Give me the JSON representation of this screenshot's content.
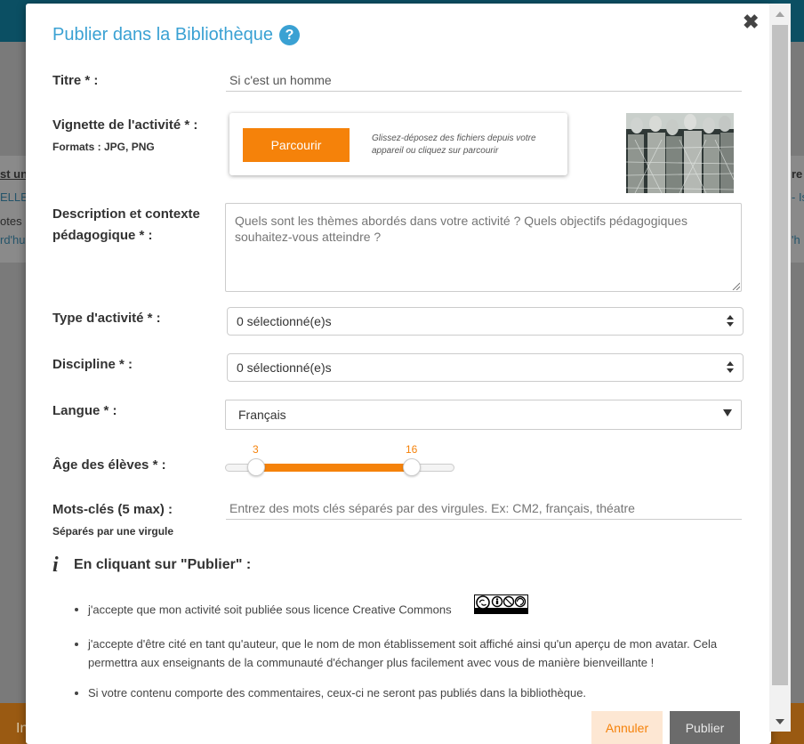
{
  "background": {
    "left_texts": [
      "st un",
      "ELLE",
      "otes",
      "rd'hu"
    ],
    "right_texts": [
      "re",
      "- Is",
      "'h"
    ],
    "bottom_text": "In"
  },
  "modal": {
    "title": "Publier dans la Bibliothèque",
    "help_glyph": "?",
    "close_glyph": "✖",
    "fields": {
      "titre_label": "Titre * :",
      "titre_value": "Si c'est un homme",
      "vignette_label": "Vignette de l'activité * :",
      "vignette_formats": "Formats : JPG, PNG",
      "browse_label": "Parcourir",
      "drop_hint": "Glissez-déposez des fichiers depuis votre appareil ou cliquez sur parcourir",
      "description_label_1": "Description et contexte",
      "description_label_2": "pédagogique * :",
      "description_placeholder": "Quels sont les thèmes abordés dans votre activité ? Quels objectifs pédagogiques souhaitez-vous atteindre ?",
      "type_label": "Type d'activité * :",
      "type_value": "0 sélectionné(e)s",
      "discipline_label": "Discipline * :",
      "discipline_value": "0 sélectionné(e)s",
      "langue_label": "Langue * :",
      "langue_value": "Français",
      "age_label": "Âge des élèves * :",
      "age_min": "3",
      "age_max": "16",
      "keywords_label": "Mots-clés (5 max) :",
      "keywords_sublabel": "Séparés par une virgule",
      "keywords_placeholder": "Entrez des mots clés séparés par des virgules. Ex: CM2, français, théatre"
    },
    "info": {
      "icon": "i",
      "title": "En cliquant sur \"Publier\" :",
      "bullets": [
        "j'accepte que mon activité soit publiée sous licence Creative Commons",
        "j'accepte d'être cité en tant qu'auteur, que le nom de mon établissement soit affiché ainsi qu'un aperçu de mon avatar. Cela permettra aux enseignants de la communauté d'échanger plus facilement avec vous de manière bienveillante !",
        "Si votre contenu comporte des commentaires, ceux-ci ne seront pas publiés dans la bibliothèque."
      ]
    },
    "buttons": {
      "cancel": "Annuler",
      "publish": "Publier"
    }
  },
  "colors": {
    "accent": "#f5820a",
    "title": "#3aa1d3"
  }
}
